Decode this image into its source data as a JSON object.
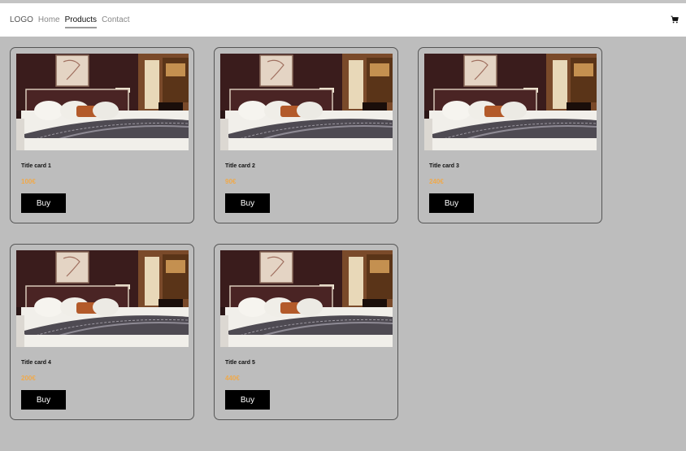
{
  "navbar": {
    "logo": "LOGO",
    "links": [
      "Home",
      "Products",
      "Contact"
    ],
    "active": "Products",
    "cart_icon": "shopping-cart-icon"
  },
  "cards": [
    {
      "title": "Title card 1",
      "price": "100€",
      "button": "Buy"
    },
    {
      "title": "Title card 2",
      "price": "90€",
      "button": "Buy"
    },
    {
      "title": "Title card 3",
      "price": "240€",
      "button": "Buy"
    },
    {
      "title": "Title card 4",
      "price": "200€",
      "button": "Buy"
    },
    {
      "title": "Title card 5",
      "price": "440€",
      "button": "Buy"
    }
  ],
  "colors": {
    "background": "#bdbdbd",
    "price": "#f0a94a",
    "button": "#000000"
  }
}
